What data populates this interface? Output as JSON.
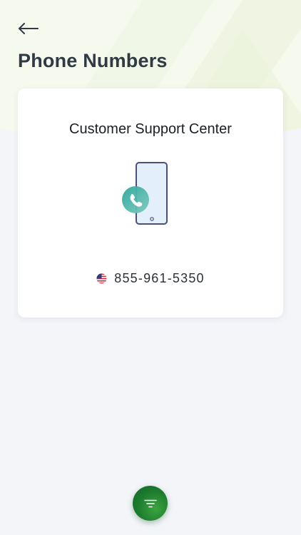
{
  "header": {
    "title": "Phone Numbers",
    "back_icon": "arrow-left-icon"
  },
  "card": {
    "title": "Customer Support Center",
    "illustration_icon": "phone-call-icon",
    "phone": {
      "flag_icon": "us-flag-icon",
      "number": "855-961-5350"
    }
  },
  "fab": {
    "icon": "menu-lines-icon",
    "color": "#1d7a2e"
  },
  "colors": {
    "background": "#f3f5f9",
    "header_bg": "#f6f9ee",
    "title_text": "#2f3a45",
    "accent_teal": "#2f9e96"
  }
}
